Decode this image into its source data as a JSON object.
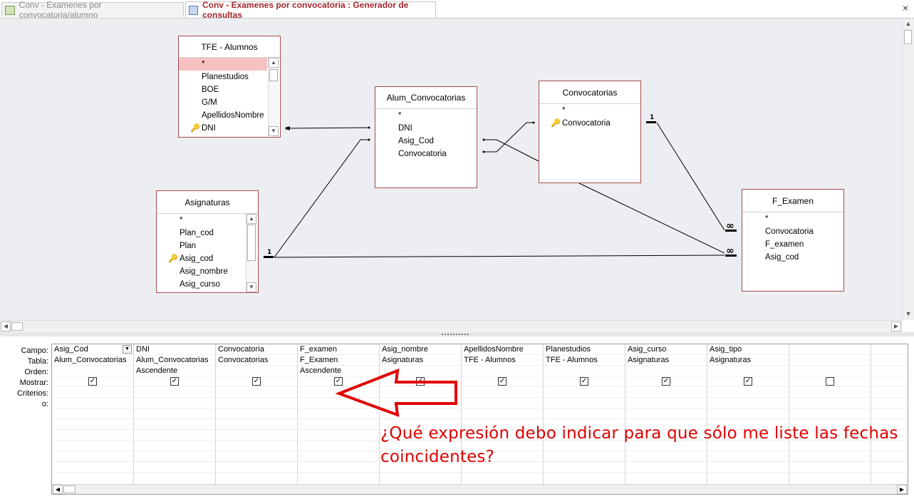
{
  "tabs": [
    {
      "label": "Conv - Examenes por convocatoria/alumno",
      "active": false
    },
    {
      "label": "Conv - Examenes por convocatoria : Generador de consultas",
      "active": true
    }
  ],
  "close_glyph": "×",
  "tables": {
    "tfe_alumnos": {
      "title": "TFE - Alumnos",
      "fields": [
        "*",
        "Planestudios",
        "BOE",
        "G/M",
        "ApellidosNombre",
        "DNI"
      ],
      "key_field": "DNI"
    },
    "alum_convocatorias": {
      "title": "Alum_Convocatorias",
      "fields": [
        "*",
        "DNI",
        "Asig_Cod",
        "Convocatoria"
      ]
    },
    "convocatorias": {
      "title": "Convocatorias",
      "fields": [
        "*",
        "Convocatoria"
      ],
      "key_field": "Convocatoria"
    },
    "asignaturas": {
      "title": "Asignaturas",
      "fields": [
        "*",
        "Plan_cod",
        "Plan",
        "Asig_cod",
        "Asig_nombre",
        "Asig_curso"
      ],
      "key_field": "Asig_cod"
    },
    "f_examen": {
      "title": "F_Examen",
      "fields": [
        "*",
        "Convocatoria",
        "F_examen",
        "Asig_cod"
      ]
    }
  },
  "relations": {
    "one_label": "1",
    "many_label": "∞"
  },
  "qbe": {
    "row_labels": [
      "Campo:",
      "Tabla:",
      "Orden:",
      "Mostrar:",
      "Criterios:",
      "o:"
    ],
    "columns": [
      {
        "campo": "Asig_Cod",
        "tabla": "Alum_Convocatorias",
        "orden": "",
        "mostrar": true
      },
      {
        "campo": "DNI",
        "tabla": "Alum_Convocatorias",
        "orden": "Ascendente",
        "mostrar": true
      },
      {
        "campo": "Convocatoria",
        "tabla": "Convocatorias",
        "orden": "",
        "mostrar": true
      },
      {
        "campo": "F_examen",
        "tabla": "F_Examen",
        "orden": "Ascendente",
        "mostrar": true
      },
      {
        "campo": "Asig_nombre",
        "tabla": "Asignaturas",
        "orden": "",
        "mostrar": true
      },
      {
        "campo": "ApellidosNombre",
        "tabla": "TFE - Alumnos",
        "orden": "",
        "mostrar": true
      },
      {
        "campo": "Planestudios",
        "tabla": "TFE - Alumnos",
        "orden": "",
        "mostrar": true
      },
      {
        "campo": "Asig_curso",
        "tabla": "Asignaturas",
        "orden": "",
        "mostrar": true
      },
      {
        "campo": "Asig_tipo",
        "tabla": "Asignaturas",
        "orden": "",
        "mostrar": true
      },
      {
        "campo": "",
        "tabla": "",
        "orden": "",
        "mostrar": false
      },
      {
        "campo": "",
        "tabla": "",
        "orden": "",
        "mostrar": null
      }
    ]
  },
  "annotation": {
    "text": "¿Qué expresión debo indicar para que sólo me liste las fechas coincidentes?",
    "color": "#e00000"
  }
}
